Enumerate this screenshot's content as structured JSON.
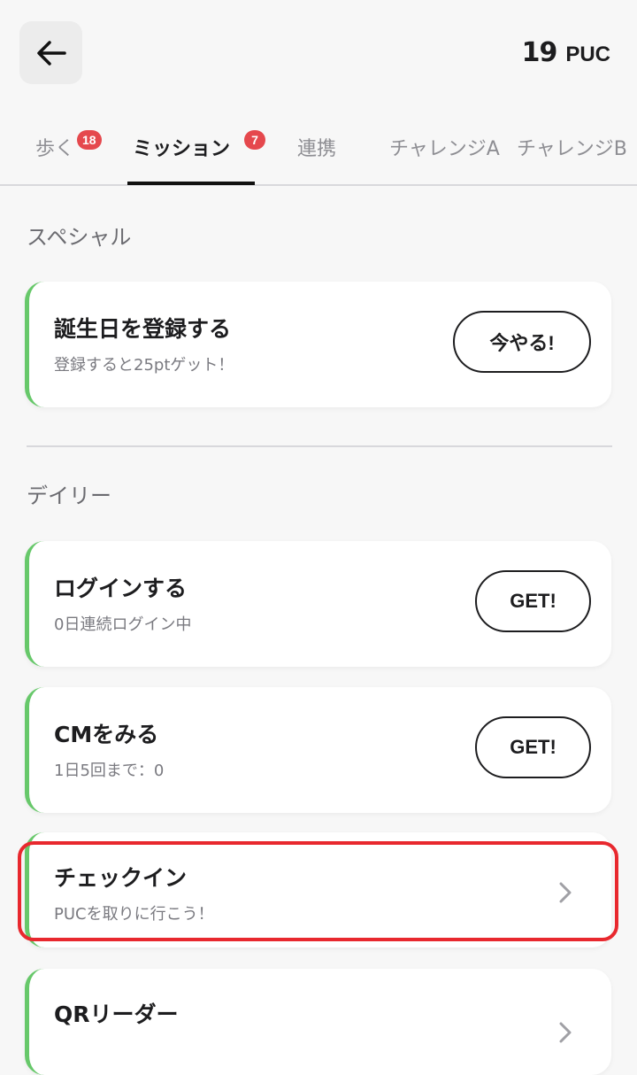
{
  "header": {
    "puc_count": "19",
    "puc_unit": "PUC"
  },
  "tabs": [
    {
      "label": "歩く",
      "badge": "18",
      "active": false
    },
    {
      "label": "ミッション",
      "badge": "7",
      "active": true
    },
    {
      "label": "連携",
      "badge": null,
      "active": false
    },
    {
      "label": "チャレンジA",
      "badge": null,
      "active": false
    },
    {
      "label": "チャレンジB",
      "badge": null,
      "active": false
    }
  ],
  "sections": {
    "special_title": "スペシャル",
    "daily_title": "デイリー"
  },
  "cards": {
    "birthday": {
      "title": "誕生日を登録する",
      "subtitle": "登録すると25ptゲット！",
      "button": "今やる!"
    },
    "login": {
      "title": "ログインする",
      "subtitle": "0日連続ログイン中",
      "button": "GET!"
    },
    "cm": {
      "title": "CMをみる",
      "subtitle": "1日5回まで：0",
      "button": "GET!"
    },
    "checkin": {
      "title": "チェックイン",
      "subtitle": "PUCを取りに行こう！"
    },
    "qr": {
      "title": "QRリーダー",
      "subtitle": ""
    }
  },
  "colors": {
    "accent_green": "#67c86a",
    "badge_red": "#e5484d",
    "highlight_red": "#e8282e"
  },
  "icons": {
    "back": "arrow-left-icon",
    "chevron": "chevron-right-icon"
  }
}
